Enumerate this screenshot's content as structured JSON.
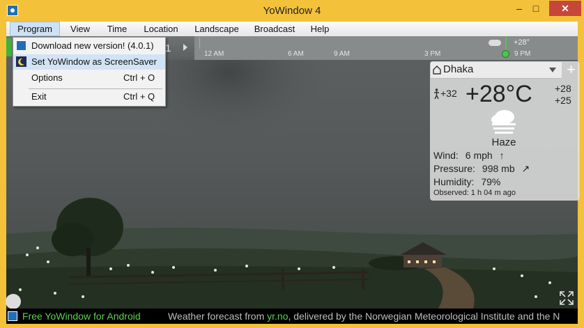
{
  "window": {
    "title": "YoWindow 4",
    "minimize": "–",
    "maximize": "□",
    "close": "✕"
  },
  "menu": [
    "Program",
    "View",
    "Time",
    "Location",
    "Landscape",
    "Broadcast",
    "Help"
  ],
  "program_menu": {
    "items": [
      {
        "label": "Download new version! (4.0.1)",
        "shortcut": "",
        "icon": "yowindow-icon"
      },
      {
        "label": "Set YoWindow as ScreenSaver",
        "shortcut": "",
        "icon": "moon-icon"
      },
      {
        "label": "Options",
        "shortcut": "Ctrl + O",
        "icon": ""
      },
      {
        "label": "Exit",
        "shortcut": "Ctrl + Q",
        "icon": ""
      }
    ],
    "hovered_index": 1
  },
  "timeline": {
    "day_digit": "1",
    "ticks": [
      "12 AM",
      "6 AM",
      "9 AM",
      "3 PM",
      "9 PM"
    ],
    "cursor_temp": "+28°",
    "cursor_time": "9 PM"
  },
  "weather": {
    "city": "Dhaka",
    "feels_like": "+32",
    "temperature": "+28°C",
    "high": "+28",
    "low": "+25",
    "condition": "Haze",
    "wind_label": "Wind:",
    "wind_value": "6 mph",
    "wind_arrow": "↑",
    "pressure_label": "Pressure:",
    "pressure_value": "998 mb",
    "pressure_arrow": "↗",
    "humidity_label": "Humidity:",
    "humidity_value": "79%",
    "observed": "Observed:  1 h 04 m ago",
    "add_button": "+"
  },
  "status": {
    "promo": "Free YoWindow for Android",
    "credit_prefix": "Weather forecast from ",
    "credit_link": "yr.no",
    "credit_suffix": ", delivered by the Norwegian Meteorological Institute and the N"
  },
  "colors": {
    "accent_green": "#5fd04f",
    "frame": "#f3c13a",
    "close": "#c7463a"
  }
}
